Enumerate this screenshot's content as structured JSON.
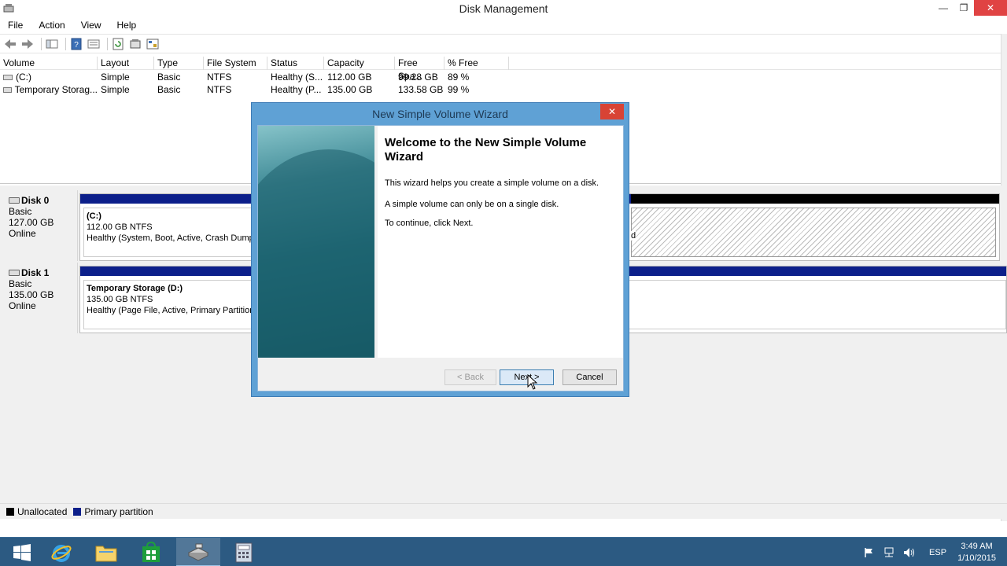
{
  "window": {
    "title": "Disk Management",
    "min": "—",
    "max": "❐",
    "close": "✕"
  },
  "menu": [
    "File",
    "Action",
    "View",
    "Help"
  ],
  "volume_list": {
    "columns": [
      "Volume",
      "Layout",
      "Type",
      "File System",
      "Status",
      "Capacity",
      "Free Spa...",
      "% Free"
    ],
    "rows": [
      [
        "(C:)",
        "Simple",
        "Basic",
        "NTFS",
        "Healthy (S...",
        "112.00 GB",
        "99.28 GB",
        "89 %"
      ],
      [
        "Temporary Storag...",
        "Simple",
        "Basic",
        "NTFS",
        "Healthy (P...",
        "135.00 GB",
        "133.58 GB",
        "99 %"
      ]
    ]
  },
  "disks": [
    {
      "name": "Disk 0",
      "type": "Basic",
      "size": "127.00 GB",
      "state": "Online",
      "partition": {
        "name": "(C:)",
        "size_fs": "112.00 GB NTFS",
        "status": "Healthy (System, Boot, Active, Crash Dump"
      },
      "unalloc_tail": "d"
    },
    {
      "name": "Disk 1",
      "type": "Basic",
      "size": "135.00 GB",
      "state": "Online",
      "partition": {
        "name": "Temporary Storage  (D:)",
        "size_fs": "135.00 GB NTFS",
        "status": "Healthy (Page File, Active, Primary Partition"
      }
    }
  ],
  "legend": {
    "items": [
      {
        "label": "Unallocated",
        "color": "#000000"
      },
      {
        "label": "Primary partition",
        "color": "#0c1f8a"
      }
    ]
  },
  "dialog": {
    "title": "New Simple Volume Wizard",
    "close": "✕",
    "heading": "Welcome to the New Simple Volume Wizard",
    "p1": "This wizard helps you create a simple volume on a disk.",
    "p2": "A simple volume can only be on a single disk.",
    "p3": "To continue, click Next.",
    "back": "< Back",
    "next": "Next >",
    "cancel": "Cancel"
  },
  "taskbar": {
    "lang": "ESP",
    "time": "3:49 AM",
    "date": "1/10/2015"
  },
  "colors": {
    "primary_partition": "#0c1f8a",
    "unallocated": "#000000",
    "taskbar": "#2c5a82",
    "dialog_frame": "#5fa1d5"
  }
}
